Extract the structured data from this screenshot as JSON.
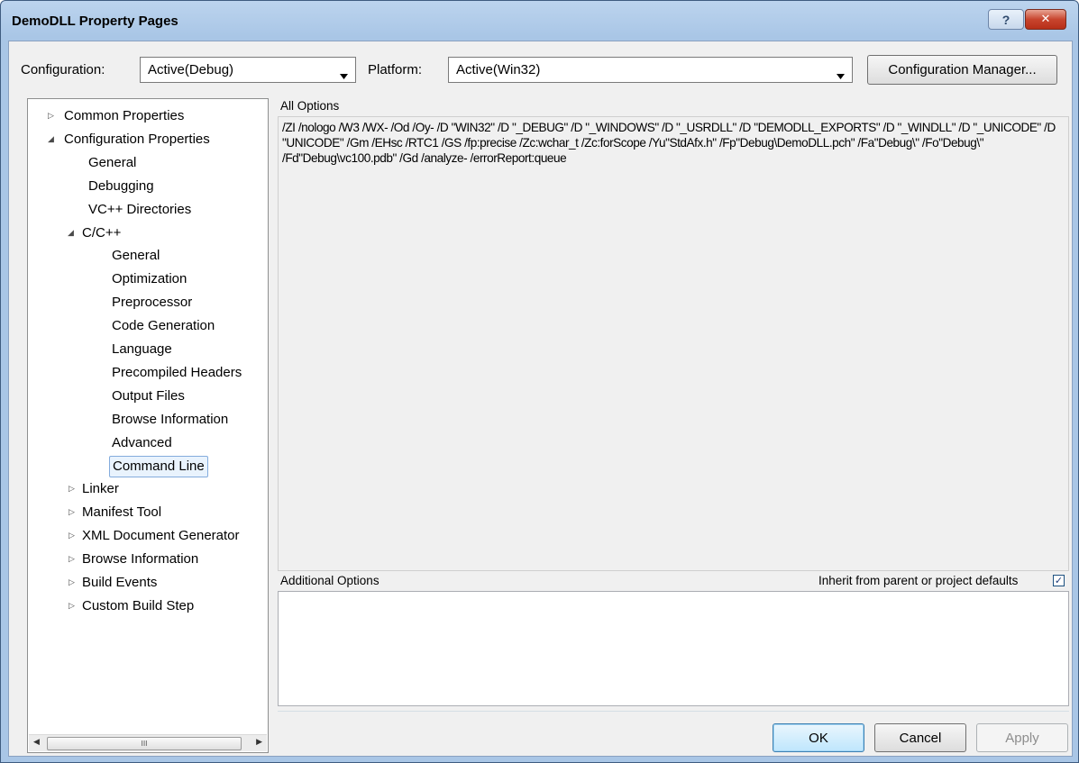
{
  "window": {
    "title": "DemoDLL Property Pages"
  },
  "toolbar": {
    "configuration_label": "Configuration:",
    "configuration_value": "Active(Debug)",
    "platform_label": "Platform:",
    "platform_value": "Active(Win32)",
    "config_manager_button": "Configuration Manager..."
  },
  "tree": {
    "items": [
      {
        "label": "Common Properties",
        "expander": "collapsed"
      },
      {
        "label": "Configuration Properties",
        "expander": "expanded"
      },
      {
        "label": "General"
      },
      {
        "label": "Debugging"
      },
      {
        "label": "VC++ Directories"
      },
      {
        "label": "C/C++",
        "expander": "expanded"
      },
      {
        "label": "General"
      },
      {
        "label": "Optimization"
      },
      {
        "label": "Preprocessor"
      },
      {
        "label": "Code Generation"
      },
      {
        "label": "Language"
      },
      {
        "label": "Precompiled Headers"
      },
      {
        "label": "Output Files"
      },
      {
        "label": "Browse Information"
      },
      {
        "label": "Advanced"
      },
      {
        "label": "Command Line",
        "selected": true
      },
      {
        "label": "Linker",
        "expander": "collapsed"
      },
      {
        "label": "Manifest Tool",
        "expander": "collapsed"
      },
      {
        "label": "XML Document Generator",
        "expander": "collapsed"
      },
      {
        "label": "Browse Information",
        "expander": "collapsed"
      },
      {
        "label": "Build Events",
        "expander": "collapsed"
      },
      {
        "label": "Custom Build Step",
        "expander": "collapsed"
      }
    ],
    "scroll_thumb_glyph": "III"
  },
  "options": {
    "all_options_label": "All Options",
    "all_options_text": "/ZI /nologo /W3 /WX- /Od /Oy- /D \"WIN32\" /D \"_DEBUG\" /D \"_WINDOWS\" /D \"_USRDLL\" /D \"DEMODLL_EXPORTS\" /D \"_WINDLL\" /D \"_UNICODE\" /D \"UNICODE\" /Gm /EHsc /RTC1 /GS /fp:precise /Zc:wchar_t /Zc:forScope /Yu\"StdAfx.h\" /Fp\"Debug\\DemoDLL.pch\" /Fa\"Debug\\\" /Fo\"Debug\\\" /Fd\"Debug\\vc100.pdb\" /Gd /analyze- /errorReport:queue",
    "additional_label": "Additional Options",
    "inherit_label": "Inherit from parent or project defaults",
    "inherit_checked": true,
    "additional_value": ""
  },
  "buttons": {
    "ok": "OK",
    "cancel": "Cancel",
    "apply": "Apply"
  },
  "glyphs": {
    "help": "?",
    "close": "✕",
    "dropdown": "▼",
    "checkmark": "✓"
  }
}
